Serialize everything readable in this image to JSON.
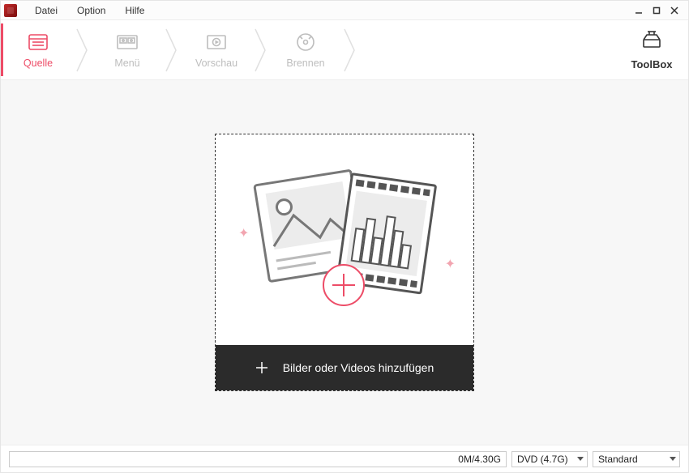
{
  "menubar": {
    "file": "Datei",
    "option": "Option",
    "help": "Hilfe"
  },
  "stepnav": {
    "source": "Quelle",
    "menu": "Menü",
    "preview": "Vorschau",
    "burn": "Brennen",
    "toolbox": "ToolBox"
  },
  "dropzone": {
    "add_label": "Bilder oder Videos hinzufügen"
  },
  "status": {
    "progress_text": "0M/4.30G",
    "disc_option": "DVD (4.7G)",
    "quality_option": "Standard"
  }
}
